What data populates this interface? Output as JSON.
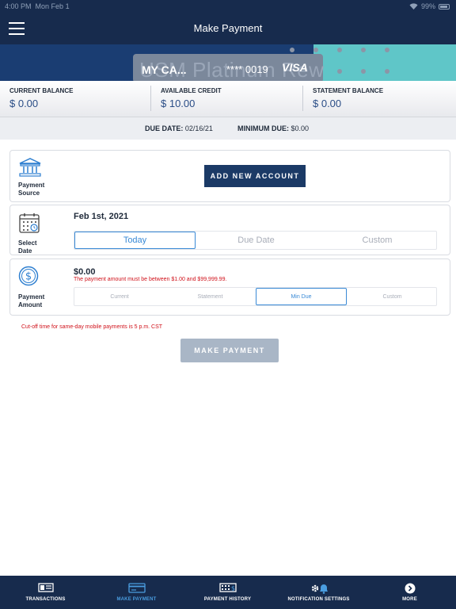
{
  "status_bar": {
    "time": "4:00 PM",
    "date": "Mon Feb 1",
    "battery": "99%"
  },
  "header": {
    "title": "Make Payment"
  },
  "card": {
    "watermark": "USM Platinum Rew",
    "name": "MY CA...",
    "number": "**** 0019",
    "network": "VISA"
  },
  "balances": [
    {
      "label": "CURRENT BALANCE",
      "value": "$ 0.00"
    },
    {
      "label": "AVAILABLE CREDIT",
      "value": "$ 10.00"
    },
    {
      "label": "STATEMENT BALANCE",
      "value": "$ 0.00"
    }
  ],
  "due": {
    "due_label": "DUE DATE:",
    "due_value": "02/16/21",
    "min_label": "MINIMUM DUE:",
    "min_value": "$0.00"
  },
  "payment_source": {
    "label": "Payment Source",
    "button": "ADD NEW ACCOUNT"
  },
  "select_date": {
    "label": "Select Date",
    "value": "Feb 1st, 2021",
    "options": [
      "Today",
      "Due Date",
      "Custom"
    ],
    "selected": "Today"
  },
  "payment_amount": {
    "label": "Payment Amount",
    "value": "$0.00",
    "error": "The payment amount must be between $1.00 and $99,999.99.",
    "options": [
      "Current",
      "Statement",
      "Min Due",
      "Custom"
    ],
    "selected": "Min Due"
  },
  "cutoff_note": "Cut-off time for same-day mobile payments is 5 p.m. CST",
  "submit_label": "MAKE PAYMENT",
  "tabs": [
    {
      "label": "TRANSACTIONS",
      "icon": "transactions-icon"
    },
    {
      "label": "MAKE PAYMENT",
      "icon": "card-payment-icon",
      "active": true
    },
    {
      "label": "PAYMENT HISTORY",
      "icon": "payment-history-icon"
    },
    {
      "label": "NOTIFICATION SETTINGS",
      "icon": "notification-settings-icon"
    },
    {
      "label": "MORE",
      "icon": "more-icon"
    }
  ],
  "colors": {
    "navy": "#172b4d",
    "teal": "#5fc6c8",
    "accent_blue": "#3a8ad6",
    "error_red": "#d0121b",
    "button_navy": "#1b3a66",
    "disabled_button": "#a9b6c6"
  }
}
